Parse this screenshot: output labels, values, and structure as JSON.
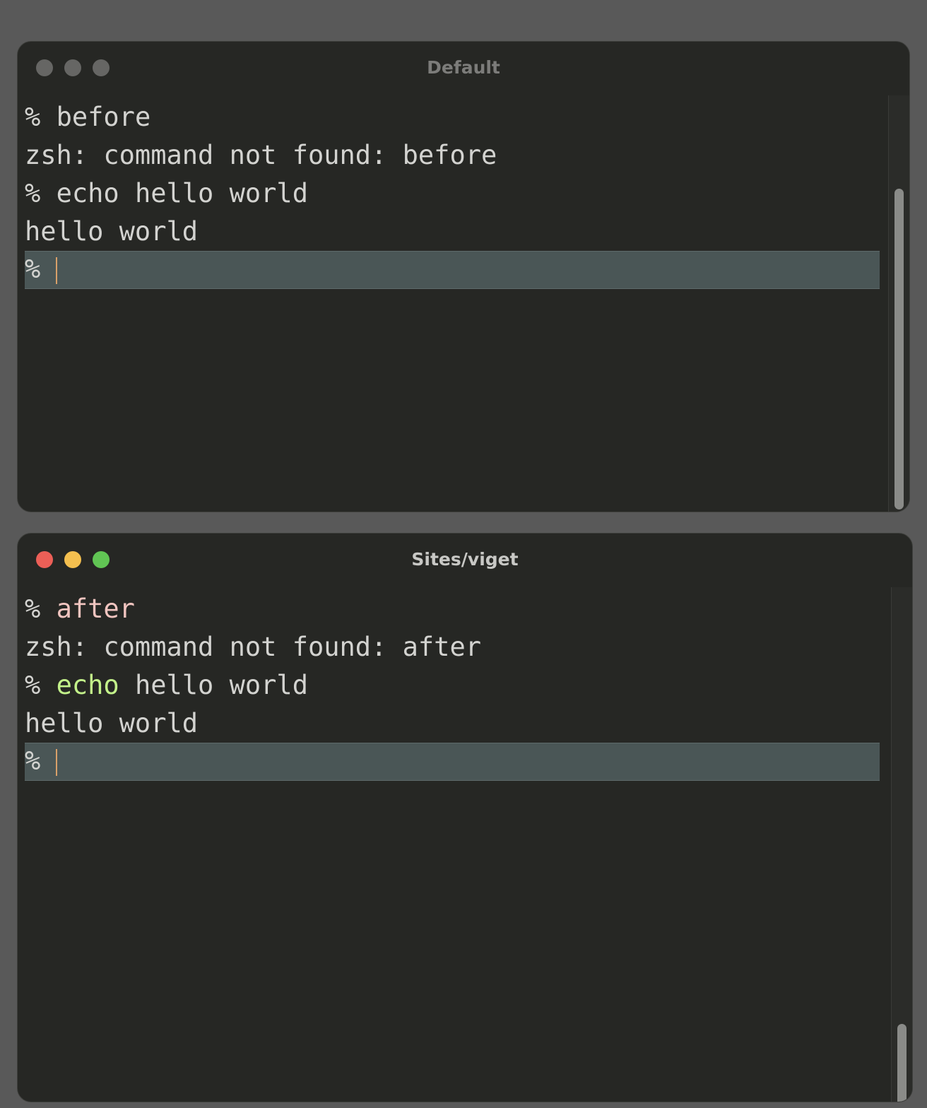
{
  "windows": [
    {
      "title": "Default",
      "title_color": "#7c7c7a",
      "lights": [
        "#666664",
        "#666664",
        "#666664"
      ],
      "lines": [
        {
          "prompt": "% ",
          "cmd": "before",
          "cmd_color": "#d3d3d0",
          "rest": ""
        },
        {
          "text": "zsh: command not found: before"
        },
        {
          "prompt": "% ",
          "cmd": "echo",
          "cmd_color": "#d3d3d0",
          "rest": " hello world"
        },
        {
          "text": "hello world"
        }
      ],
      "current_prompt": "% "
    },
    {
      "title": "Sites/viget",
      "title_color": "#c8c8c5",
      "lights": [
        "#ec5f57",
        "#f4bf4f",
        "#61c554"
      ],
      "lines": [
        {
          "prompt": "% ",
          "cmd": "after",
          "cmd_color": "#f2c5c0",
          "rest": ""
        },
        {
          "text": "zsh: command not found: after"
        },
        {
          "prompt": "% ",
          "cmd": "echo",
          "cmd_color": "#c3f28a",
          "rest": " hello world"
        },
        {
          "text": "hello world"
        }
      ],
      "current_prompt": "% "
    }
  ]
}
